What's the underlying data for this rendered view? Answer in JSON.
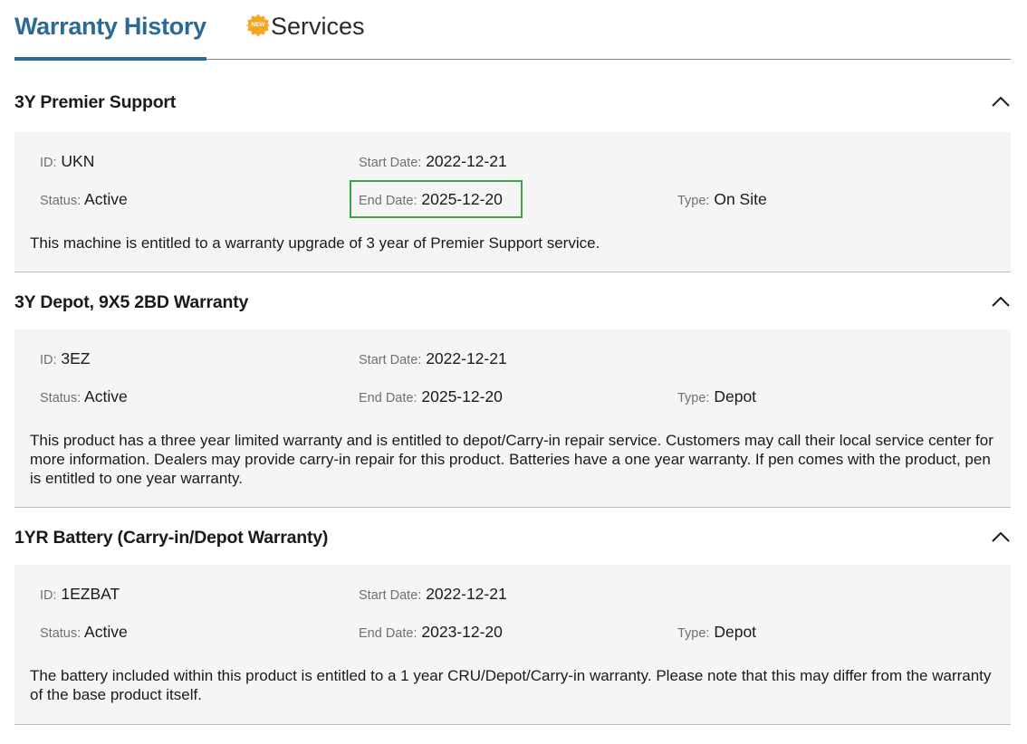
{
  "tabs": {
    "warranty_history": "Warranty History",
    "new_badge": "NEW",
    "services": "Services"
  },
  "sections": [
    {
      "title": "3Y Premier Support",
      "id_label": "ID:",
      "id": "UKN",
      "status_label": "Status:",
      "status": "Active",
      "start_label": "Start Date:",
      "start": "2022-12-21",
      "end_label": "End Date:",
      "end": "2025-12-20",
      "type_label": "Type:",
      "type": "On Site",
      "description": "This machine is entitled to a warranty upgrade of 3 year of Premier Support service."
    },
    {
      "title": "3Y Depot, 9X5 2BD Warranty",
      "id_label": "ID:",
      "id": "3EZ",
      "status_label": "Status:",
      "status": "Active",
      "start_label": "Start Date:",
      "start": "2022-12-21",
      "end_label": "End Date:",
      "end": "2025-12-20",
      "type_label": "Type:",
      "type": "Depot",
      "description": "This product has a three year limited warranty and is entitled to depot/Carry-in repair service. Customers may call their local service center for more information. Dealers may provide carry-in repair for this product. Batteries have a one year warranty. If pen comes with the product, pen is entitled to one year warranty."
    },
    {
      "title": "1YR Battery (Carry-in/Depot Warranty)",
      "id_label": "ID:",
      "id": "1EZBAT",
      "status_label": "Status:",
      "status": "Active",
      "start_label": "Start Date:",
      "start": "2022-12-21",
      "end_label": "End Date:",
      "end": "2023-12-20",
      "type_label": "Type:",
      "type": "Depot",
      "description": "The battery included within this product is entitled to a 1 year CRU/Depot/Carry-in warranty. Please note that this may differ from the warranty of the base product itself."
    }
  ],
  "colors": {
    "accent": "#2b6a94",
    "highlight_box": "#3aa34a",
    "badge": "#f5a623",
    "panel_bg": "#f5f5f5"
  }
}
